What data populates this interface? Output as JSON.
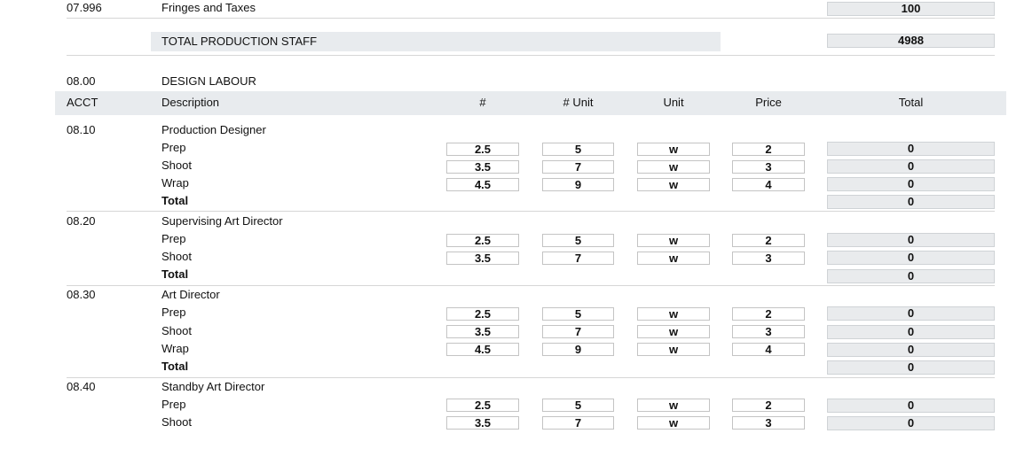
{
  "top": {
    "fringes": {
      "acct": "07.996",
      "label": "Fringes and Taxes",
      "total": "100"
    },
    "tps": {
      "label": "TOTAL PRODUCTION STAFF",
      "total": "4988"
    }
  },
  "section": {
    "acct": "08.00",
    "title": "DESIGN LABOUR"
  },
  "columns": {
    "acct": "ACCT",
    "description": "Description",
    "num": "#",
    "num_unit": "# Unit",
    "unit": "Unit",
    "price": "Price",
    "total": "Total"
  },
  "groups": [
    {
      "acct": "08.10",
      "title": "Production Designer",
      "total_label": "Total",
      "total": "0",
      "rows": [
        {
          "label": "Prep",
          "num": "2.5",
          "num_unit": "5",
          "unit": "w",
          "price": "2",
          "total": "0"
        },
        {
          "label": "Shoot",
          "num": "3.5",
          "num_unit": "7",
          "unit": "w",
          "price": "3",
          "total": "0"
        },
        {
          "label": "Wrap",
          "num": "4.5",
          "num_unit": "9",
          "unit": "w",
          "price": "4",
          "total": "0"
        }
      ]
    },
    {
      "acct": "08.20",
      "title": "Supervising Art Director",
      "total_label": "Total",
      "total": "0",
      "rows": [
        {
          "label": "Prep",
          "num": "2.5",
          "num_unit": "5",
          "unit": "w",
          "price": "2",
          "total": "0"
        },
        {
          "label": "Shoot",
          "num": "3.5",
          "num_unit": "7",
          "unit": "w",
          "price": "3",
          "total": "0"
        }
      ]
    },
    {
      "acct": "08.30",
      "title": "Art Director",
      "total_label": "Total",
      "total": "0",
      "rows": [
        {
          "label": "Prep",
          "num": "2.5",
          "num_unit": "5",
          "unit": "w",
          "price": "2",
          "total": "0"
        },
        {
          "label": "Shoot",
          "num": "3.5",
          "num_unit": "7",
          "unit": "w",
          "price": "3",
          "total": "0"
        },
        {
          "label": "Wrap",
          "num": "4.5",
          "num_unit": "9",
          "unit": "w",
          "price": "4",
          "total": "0"
        }
      ]
    },
    {
      "acct": "08.40",
      "title": "Standby Art Director",
      "rows": [
        {
          "label": "Prep",
          "num": "2.5",
          "num_unit": "5",
          "unit": "w",
          "price": "2",
          "total": "0"
        },
        {
          "label": "Shoot",
          "num": "3.5",
          "num_unit": "7",
          "unit": "w",
          "price": "3",
          "total": "0"
        }
      ]
    }
  ]
}
